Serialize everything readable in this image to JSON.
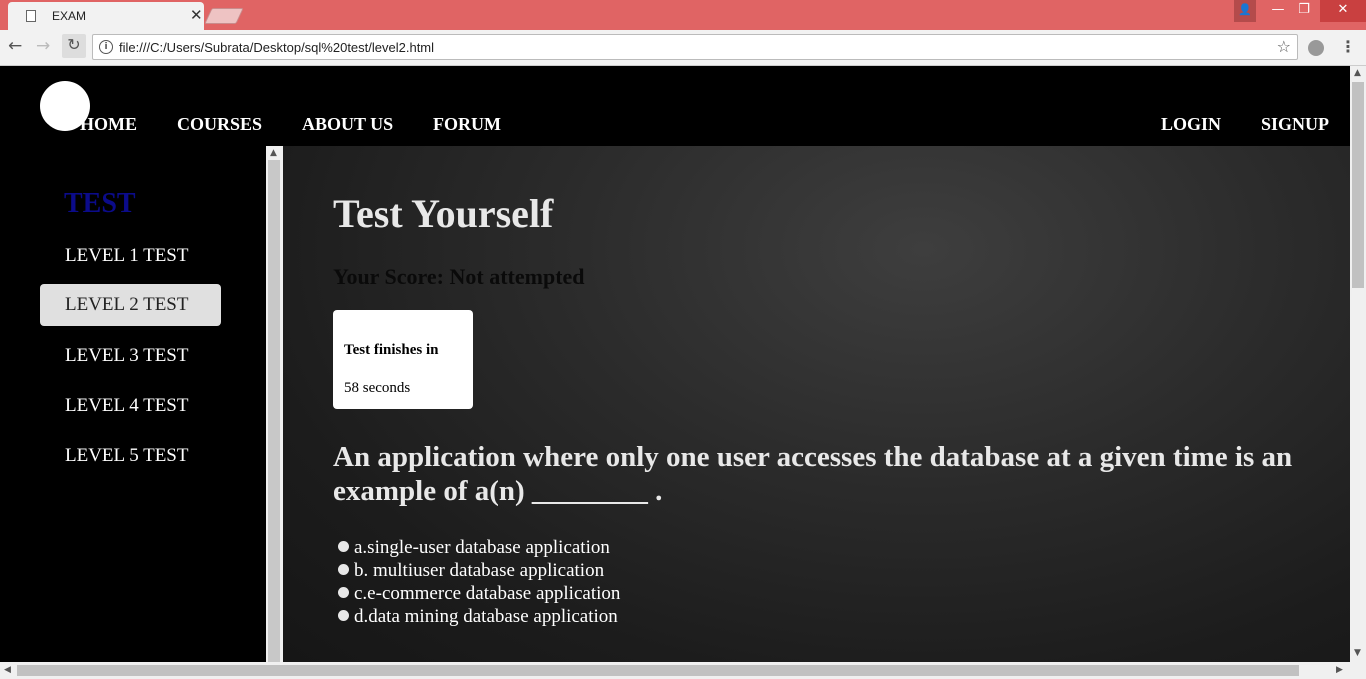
{
  "browser": {
    "tab_title": "EXAM",
    "tab_close": "✕",
    "url": "file:///C:/Users/Subrata/Desktop/sql%20test/level2.html",
    "window": {
      "min": "—",
      "max": "❐",
      "close": "✕",
      "user": "👤"
    }
  },
  "nav": {
    "home": "HOME",
    "courses": "COURSES",
    "about": "ABOUT US",
    "forum": "FORUM",
    "login": "LOGIN",
    "signup": "SIGNUP"
  },
  "sidebar": {
    "title": "TEST",
    "items": [
      {
        "label": "LEVEL 1 TEST"
      },
      {
        "label": "LEVEL 2 TEST",
        "active": true
      },
      {
        "label": "LEVEL 3 TEST"
      },
      {
        "label": "LEVEL 4 TEST"
      },
      {
        "label": "LEVEL 5 TEST"
      }
    ]
  },
  "main": {
    "title": "Test Yourself",
    "score": "Your Score: Not attempted",
    "timer_label": "Test finishes in",
    "timer_value": "58 seconds",
    "question": "An application where only one user accesses the database at a given time is an example of a(n) ________ .",
    "options": [
      "a.single-user database application",
      "b. multiuser database application",
      "c.e-commerce database application",
      "d.data mining database application"
    ]
  },
  "colors": {
    "tabbar": "#e06464",
    "sidebar_title": "#0b0b8a",
    "active_item": "#e0e0e0"
  }
}
